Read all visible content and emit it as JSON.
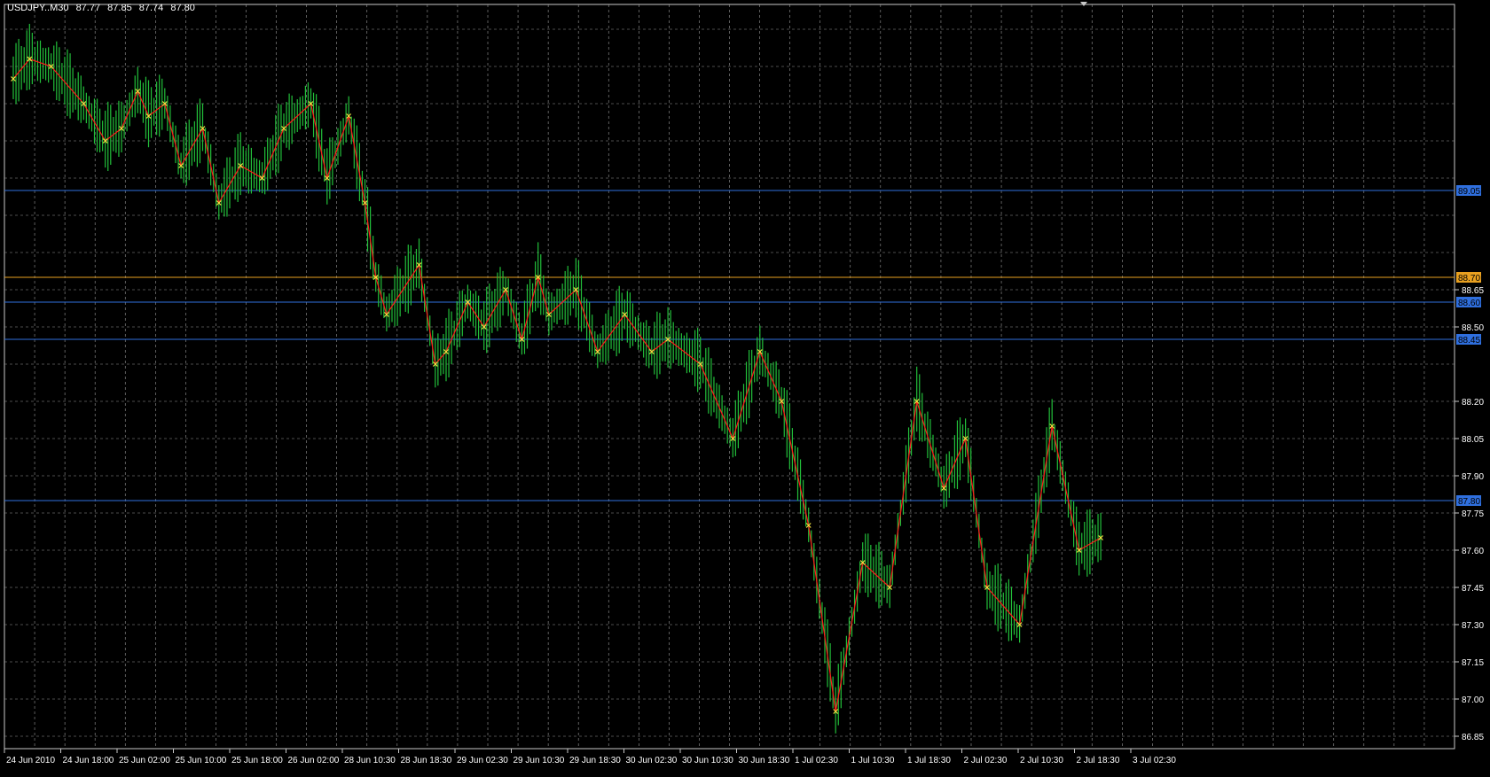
{
  "window": {
    "symbol": "USDJPY..M30",
    "ohlc": [
      "87.77",
      "87.85",
      "87.74",
      "87.80"
    ]
  },
  "chart_data": {
    "type": "line",
    "title": "",
    "xlabel": "",
    "ylabel": "",
    "ylim": [
      86.8,
      89.8
    ],
    "grid": true,
    "x_ticks": [
      "24 Jun 2010",
      "24 Jun 18:00",
      "25 Jun 02:00",
      "25 Jun 10:00",
      "25 Jun 18:00",
      "26 Jun 02:00",
      "28 Jun 10:30",
      "28 Jun 18:30",
      "29 Jun 02:30",
      "29 Jun 10:30",
      "29 Jun 18:30",
      "30 Jun 02:30",
      "30 Jun 10:30",
      "30 Jun 18:30",
      "1 Jul 02:30",
      "1 Jul 10:30",
      "1 Jul 18:30",
      "2 Jul 02:30",
      "2 Jul 10:30",
      "2 Jul 18:30",
      "3 Jul 02:30"
    ],
    "y_ticks": [
      "88.65",
      "88.50",
      "88.20",
      "88.05",
      "87.90",
      "87.75",
      "87.60",
      "87.45",
      "87.30",
      "87.15",
      "87.00",
      "86.85"
    ],
    "horizontal_lines": [
      {
        "label": "89.05",
        "value": 89.05,
        "color": "#2f6fde"
      },
      {
        "label": "88.70",
        "value": 88.7,
        "color": "#e8a020"
      },
      {
        "label": "88.60",
        "value": 88.6,
        "color": "#2f6fde"
      },
      {
        "label": "88.45",
        "value": 88.45,
        "color": "#2f6fde"
      },
      {
        "label": "87.80",
        "value": 87.8,
        "color": "#2f6fde"
      }
    ],
    "series": [
      {
        "color": "#ff1a1a",
        "x": [
          0,
          3,
          7,
          13,
          17,
          20,
          23,
          25,
          28,
          31,
          35,
          38,
          42,
          46,
          50,
          55,
          58,
          62,
          65,
          67,
          69,
          75,
          78,
          80,
          84,
          87,
          91,
          94,
          97,
          99,
          104,
          108,
          113,
          118,
          121,
          127,
          133,
          138,
          142,
          147,
          152,
          157,
          162,
          167,
          172,
          176,
          180,
          186,
          192,
          197,
          201
        ],
        "values": [
          89.5,
          89.58,
          89.55,
          89.4,
          89.25,
          89.3,
          89.45,
          89.35,
          89.4,
          89.15,
          89.3,
          89.0,
          89.15,
          89.1,
          89.3,
          89.4,
          89.1,
          89.35,
          89.0,
          88.7,
          88.55,
          88.75,
          88.35,
          88.4,
          88.6,
          88.5,
          88.65,
          88.45,
          88.7,
          88.55,
          88.65,
          88.4,
          88.55,
          88.4,
          88.45,
          88.35,
          88.05,
          88.4,
          88.2,
          87.7,
          86.95,
          87.55,
          87.45,
          88.2,
          87.85,
          88.05,
          87.45,
          87.3,
          88.1,
          87.6,
          87.65
        ]
      }
    ]
  },
  "axis": {
    "bg_color": "#000000",
    "grid_color": "#9a9a9a",
    "text_color": "#ffffff",
    "bar_color": "#22c03a",
    "marker_color": "#f4e542"
  }
}
